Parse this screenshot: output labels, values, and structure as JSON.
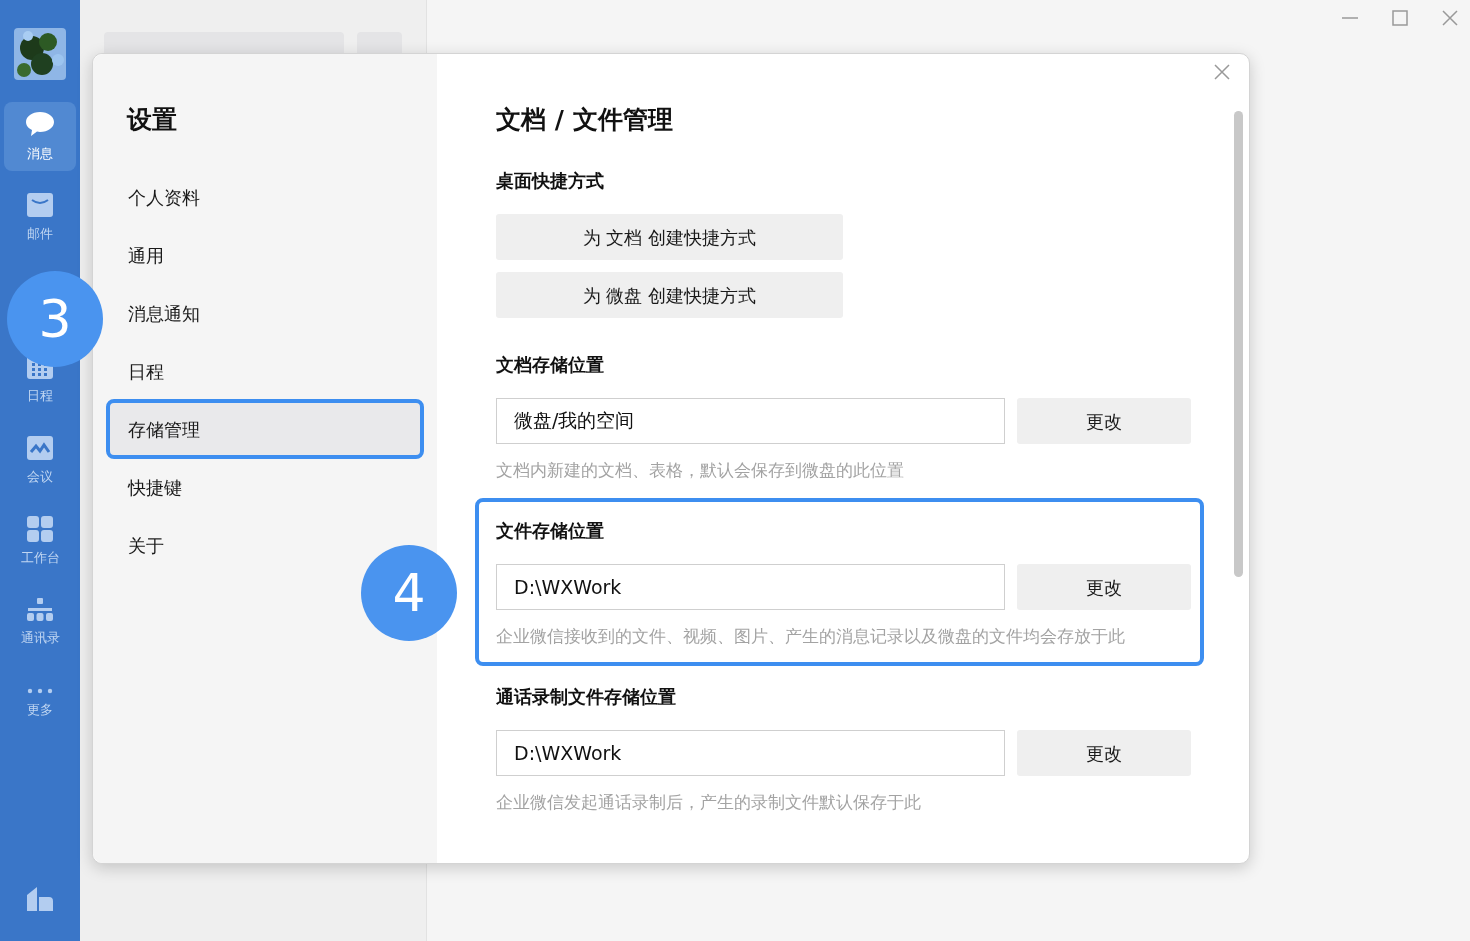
{
  "rail": {
    "items": [
      {
        "label": "消息",
        "selected": true
      },
      {
        "label": "邮件",
        "selected": false
      },
      {
        "label": "日程",
        "selected": false
      },
      {
        "label": "会议",
        "selected": false
      },
      {
        "label": "工作台",
        "selected": false
      },
      {
        "label": "通讯录",
        "selected": false
      },
      {
        "label": "更多",
        "selected": false
      }
    ]
  },
  "dialog": {
    "sidebar": {
      "title": "设置",
      "items": [
        {
          "label": "个人资料",
          "selected": false
        },
        {
          "label": "通用",
          "selected": false
        },
        {
          "label": "消息通知",
          "selected": false
        },
        {
          "label": "日程",
          "selected": false
        },
        {
          "label": "存储管理",
          "selected": true,
          "callout": "3"
        },
        {
          "label": "快捷键",
          "selected": false
        },
        {
          "label": "关于",
          "selected": false
        }
      ]
    },
    "title": "文档 / 文件管理",
    "sections": [
      {
        "kind": "buttons",
        "heading": "桌面快捷方式",
        "buttons": [
          "为 文档 创建快捷方式",
          "为 微盘 创建快捷方式"
        ]
      },
      {
        "kind": "path",
        "heading": "文档存储位置",
        "value": "微盘/我的空间",
        "button": "更改",
        "note": "文档内新建的文档、表格，默认会保存到微盘的此位置"
      },
      {
        "kind": "path",
        "heading": "文件存储位置",
        "value": "D:\\WXWork",
        "button": "更改",
        "note": "企业微信接收到的文件、视频、图片、产生的消息记录以及微盘的文件均会存放于此",
        "callout": "4"
      },
      {
        "kind": "path",
        "heading": "通话录制文件存储位置",
        "value": "D:\\WXWork",
        "button": "更改",
        "note": "企业微信发起通话录制后，产生的录制文件默认保存于此"
      }
    ]
  }
}
